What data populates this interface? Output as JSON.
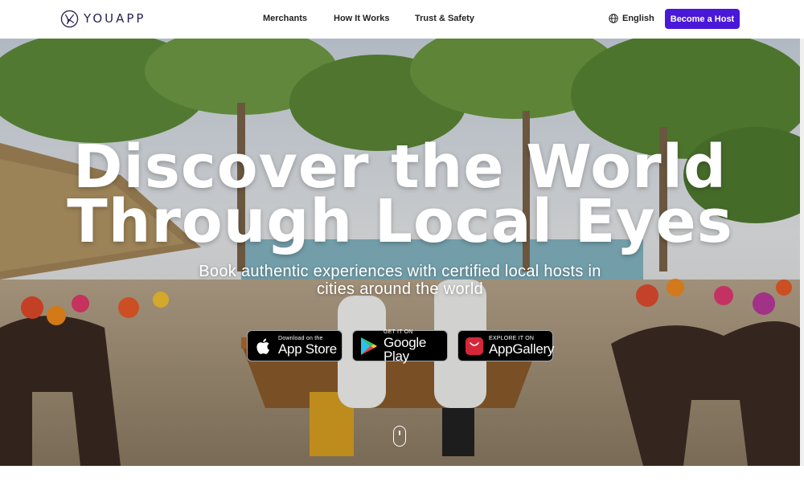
{
  "brand": {
    "name": "YOUAPP",
    "accent": "#4a18d8",
    "logo_color": "#2a2350"
  },
  "nav": {
    "items": [
      {
        "label": "Merchants"
      },
      {
        "label": "How It Works"
      },
      {
        "label": "Trust & Safety"
      }
    ],
    "language": "English",
    "cta": "Become a Host"
  },
  "hero": {
    "title_line1": "Discover the World",
    "title_line2": "Through Local Eyes",
    "subtitle": "Book authentic experiences with certified local hosts in cities around the world",
    "stores": [
      {
        "small": "Download on the",
        "big": "App Store",
        "icon": "apple-icon"
      },
      {
        "small": "GET IT ON",
        "big": "Google Play",
        "icon": "google-play-icon"
      },
      {
        "small": "EXPLORE IT ON",
        "big": "AppGallery",
        "icon": "huawei-icon"
      }
    ],
    "scroll_hint_icon": "mouse-scroll-icon"
  }
}
